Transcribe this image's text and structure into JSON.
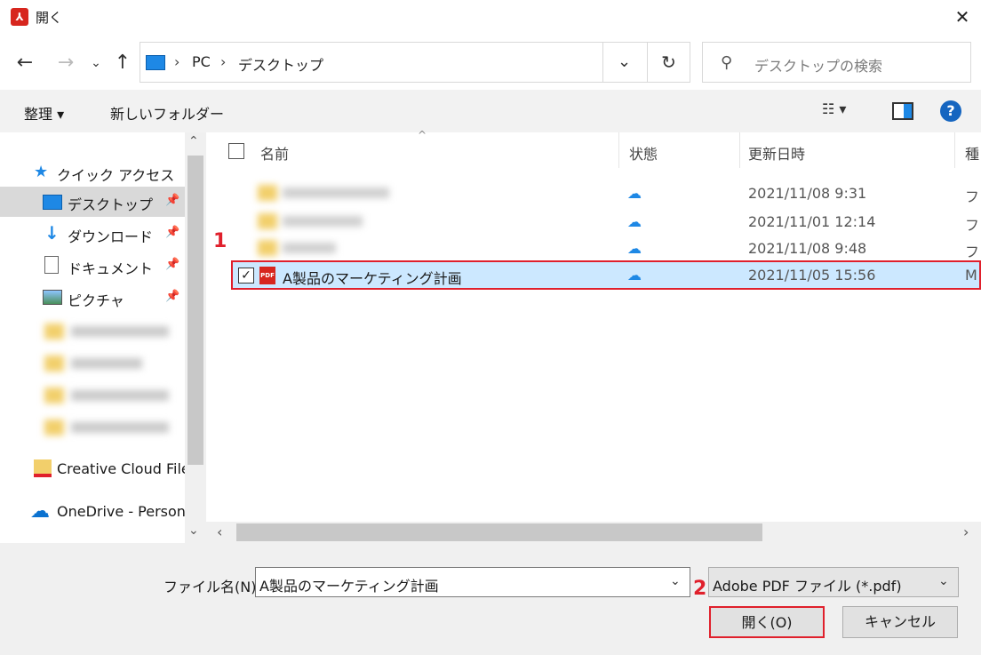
{
  "window": {
    "title": "開く",
    "app_icon": "acrobat-icon"
  },
  "nav": {
    "back": "←",
    "forward": "→",
    "recent": "⌄",
    "up": "↑",
    "breadcrumb": [
      "PC",
      "デスクトップ"
    ],
    "refresh": "↻",
    "search_placeholder": "デスクトップの検索"
  },
  "toolbar": {
    "organize": "整理 ▾",
    "new_folder": "新しいフォルダー",
    "help": "?"
  },
  "sidebar": {
    "quick_access": "クイック アクセス",
    "pinned": [
      {
        "label": "デスクトップ",
        "icon": "desktop-icon"
      },
      {
        "label": "ダウンロード",
        "icon": "download-icon"
      },
      {
        "label": "ドキュメント",
        "icon": "document-icon"
      },
      {
        "label": "ピクチャ",
        "icon": "pictures-icon"
      }
    ],
    "creative_cloud": "Creative Cloud File",
    "onedrive": "OneDrive - Person"
  },
  "columns": {
    "name": "名前",
    "status": "状態",
    "modified": "更新日時",
    "type": "種"
  },
  "files": [
    {
      "date": "2021/11/08 9:31",
      "type": "フ"
    },
    {
      "date": "2021/11/01 12:14",
      "type": "フ"
    },
    {
      "date": "2021/11/08 9:48",
      "type": "フ"
    }
  ],
  "selected_file": {
    "name": "A製品のマーケティング計画",
    "date": "2021/11/05 15:56",
    "type": "M",
    "pdf_badge": "PDF"
  },
  "cloud_glyph": "☁",
  "bottom": {
    "filename_label": "ファイル名(N):",
    "filename_value": "A製品のマーケティング計画",
    "filetype": "Adobe PDF ファイル (*.pdf)",
    "open_button": "開く(O)",
    "cancel_button": "キャンセル"
  },
  "step_markers": [
    "1",
    "2"
  ],
  "colors": {
    "accent": "#1e88e5",
    "selection": "#cce8ff",
    "highlight_border": "#e0202c"
  }
}
